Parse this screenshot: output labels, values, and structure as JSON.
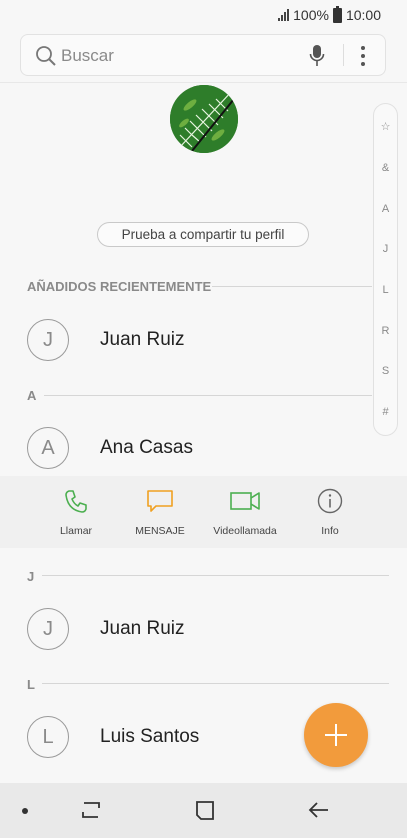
{
  "status_bar": {
    "battery_text": "100%",
    "time": "10:00"
  },
  "search": {
    "placeholder": "Buscar"
  },
  "profile": {
    "share_label": "Prueba a compartir tu perfil"
  },
  "index_bar": [
    "☆",
    "&",
    "A",
    "J",
    "L",
    "R",
    "S",
    "#"
  ],
  "sections": {
    "recent": "AÑADIDOS RECIENTEMENTE",
    "a": "A",
    "j": "J",
    "l": "L"
  },
  "contacts": [
    {
      "initial": "J",
      "name": "Juan Ruiz"
    },
    {
      "initial": "A",
      "name": "Ana Casas"
    },
    {
      "initial": "J",
      "name": "Juan Ruiz"
    },
    {
      "initial": "L",
      "name": "Luis Santos"
    }
  ],
  "actions": {
    "call": "Llamar",
    "message": "MENSAJE",
    "video": "Videollamada",
    "info": "Info"
  },
  "colors": {
    "call_green": "#4caf50",
    "message_orange": "#f0a020",
    "fab_orange": "#f29b3c"
  }
}
